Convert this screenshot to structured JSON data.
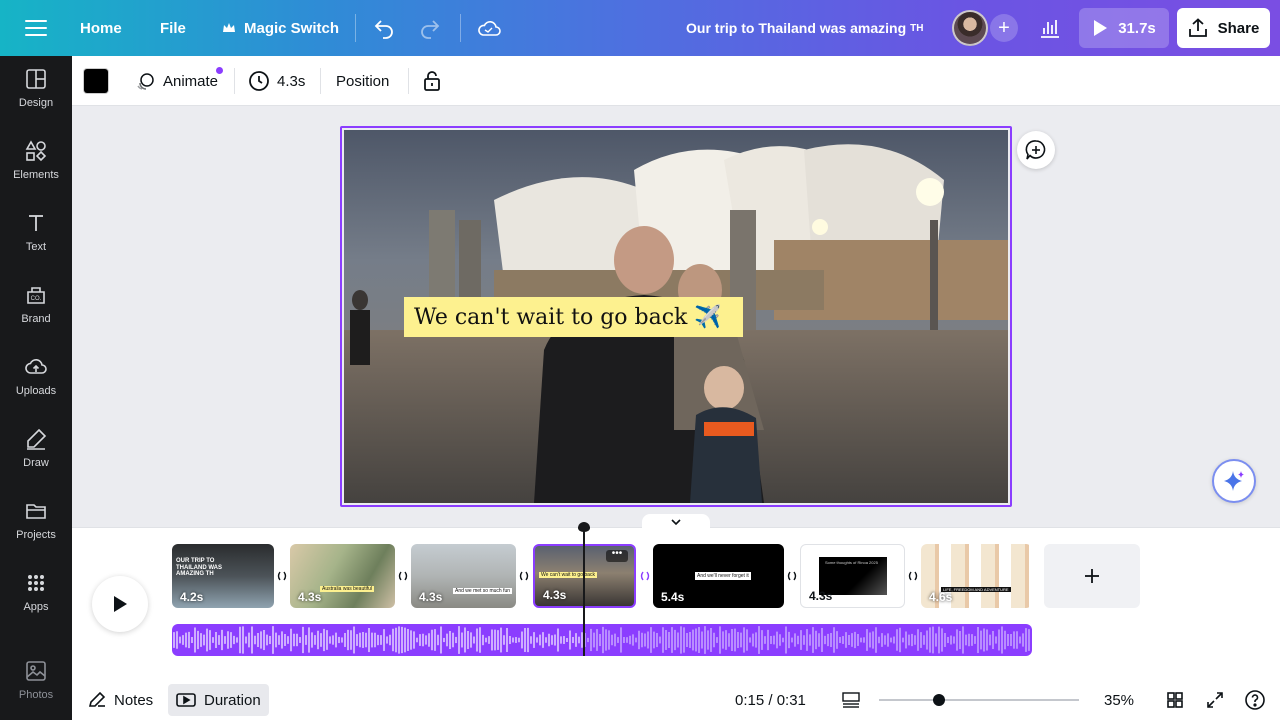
{
  "topbar": {
    "home": "Home",
    "file": "File",
    "magic_switch": "Magic Switch",
    "doc_title": "Our trip to Thailand was amazing",
    "doc_title_suffix": "TH",
    "play_duration": "31.7s",
    "share": "Share"
  },
  "sidebar": {
    "items": [
      {
        "label": "Design",
        "icon": "design-icon"
      },
      {
        "label": "Elements",
        "icon": "elements-icon"
      },
      {
        "label": "Text",
        "icon": "text-icon"
      },
      {
        "label": "Brand",
        "icon": "brand-icon"
      },
      {
        "label": "Uploads",
        "icon": "uploads-icon"
      },
      {
        "label": "Draw",
        "icon": "draw-icon"
      },
      {
        "label": "Projects",
        "icon": "projects-icon"
      },
      {
        "label": "Apps",
        "icon": "apps-icon"
      },
      {
        "label": "Photos",
        "icon": "photos-icon"
      }
    ]
  },
  "toolbar": {
    "color": "#000000",
    "animate": "Animate",
    "timing": "4.3s",
    "position": "Position"
  },
  "canvas": {
    "caption": "We can't wait to go back ✈️"
  },
  "timeline": {
    "clips": [
      {
        "duration": "4.2s",
        "thumb_text": "OUR TRIP TO THAILAND WAS AMAZING TH"
      },
      {
        "duration": "4.3s",
        "thumb_text": "Australia was beautiful"
      },
      {
        "duration": "4.3s",
        "thumb_text": "And we met so much fun"
      },
      {
        "duration": "4.3s",
        "thumb_text": "We can't wait to go back"
      },
      {
        "duration": "5.4s",
        "thumb_text": "And we'll never forget it"
      },
      {
        "duration": "4.3s",
        "thumb_text": "Some thoughts of Rinoa 2025"
      },
      {
        "duration": "4.6s",
        "thumb_text": "LIFE, FREEDOM AND ADVENTURE"
      }
    ],
    "selected_index": 3
  },
  "bottombar": {
    "notes": "Notes",
    "duration": "Duration",
    "time": "0:15 / 0:31",
    "zoom": "35%",
    "zoom_fraction": 0.3
  },
  "colors": {
    "accent": "#8b3dff",
    "caption_bg": "#fdf18f",
    "sidebar_bg": "#18191b"
  }
}
